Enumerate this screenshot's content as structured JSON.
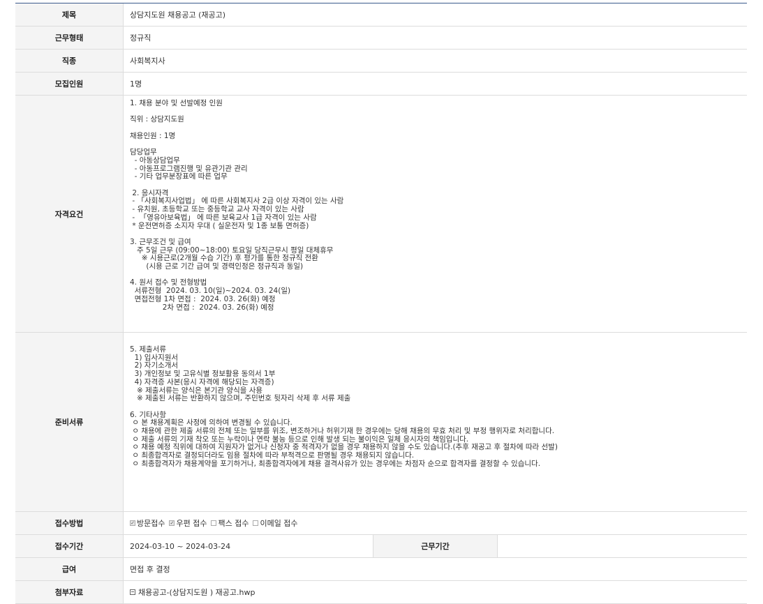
{
  "rows": {
    "title": {
      "label": "제목",
      "value": "상담지도원 채용공고 (재공고)"
    },
    "work_type": {
      "label": "근무형태",
      "value": "정규직"
    },
    "job": {
      "label": "직종",
      "value": "사회복지사"
    },
    "headcount": {
      "label": "모집인원",
      "value": "1명"
    },
    "qualification": {
      "label": "자격요건",
      "text": "1. 채용 분야 및 선발예정 인원\n\n직위 : 상담지도원\n\n채용인원 : 1명\n\n담당업무\n  - 아동상담업무\n  - 아동프로그램진행 및 유관기관 관리\n  - 기타 업무분장표에 따른 업무\n\n 2. 응시자격\n - 「사회복지사업법」 에 따른 사회복지사 2급 이상 자격이 있는 사람\n - 유치원, 초등학교 또는 중등학교 교사 자격이 있는 사람\n -  「영유아보육법」 에 따른 보육교사 1급 자격이 있는 사람\n * 운전면허증 소지자 우대 ( 실운전자 및 1종 보통 면허증)\n\n3. 근무조건 및 급여\n   주 5일 근무 (09:00~18:00) 토요일 당직근무시 평일 대체휴무\n     ※ 시용근로(2개월 수습 기간) 후 평가를 통한 정규직 전환\n       (시용 근로 기간 급여 및 경력인정은 정규직과 동일)\n\n4. 원서 접수 및 전형방법\n  서류전형  2024. 03. 10(일)~2024. 03. 24(일)\n  면접전형 1차 면접 :  2024. 03. 26(화) 예정\n              2차 면접 :  2024. 03. 26(화) 예정"
    },
    "documents": {
      "label": "준비서류",
      "text": "5. 제출서류\n  1) 입사지원서\n  2) 자기소개서\n  3) 개인정보 및 고유식별 정보활용 동의서 1부\n  4) 자격증 사본(응시 자격에 해당되는 자격증)\n   ※ 제출서류는 양식은 본기관 양식을 사용\n   ※ 제출된 서류는 반환하지 않으며, 주민번호 뒷자리 삭제 후 서류 제출\n\n6. 기타사항\n ㅇ 본 채용계획은 사정에 의하여 변경될 수 있습니다.\n ㅇ 채용에 관한 제출 서류의 전체 또는 일부를 위조, 변조하거나 허위기재 한 경우에는 당해 채용의 무효 처리 및 부정 행위자로 처리합니다.\n ㅇ 제출 서류의 기재 착오 또는 누락이나 연락 불능 등으로 인해 발생 되는 불이익은 일체 응시자의 책임입니다.\n ㅇ 채용 예정 직위에 대하여 지원자가 없거나 신청자 중 적격자가 없을 경우 채용하지 않을 수도 있습니다.(추후 재공고 후 절차에 따라 선발)\n ㅇ 최종합격자로 결정되더라도 임용 절차에 따라 부적격으로 판명될 경우 채용되지 않습니다.\n ㅇ 최종합격자가 채용계약을 포기하거나, 최종합격자에게 채용 결격사유가 있는 경우에는 차점자 순으로 합격자를 결정할 수 있습니다."
    },
    "apply_method": {
      "label": "접수방법",
      "options": [
        {
          "label": "방문접수",
          "checked": true
        },
        {
          "label": "우편 접수",
          "checked": true
        },
        {
          "label": "팩스 접수",
          "checked": false
        },
        {
          "label": "이메일 접수",
          "checked": false
        }
      ]
    },
    "apply_period": {
      "label": "접수기간",
      "value": "2024-03-10 ~ 2024-03-24",
      "work_period_label": "근무기간",
      "work_period_value": ""
    },
    "salary": {
      "label": "급여",
      "value": "면접 후 결정"
    },
    "attachment": {
      "label": "첨부자료",
      "file": "채용공고-(상담지도원 ) 재공고.hwp"
    }
  },
  "check_mark": "✓"
}
